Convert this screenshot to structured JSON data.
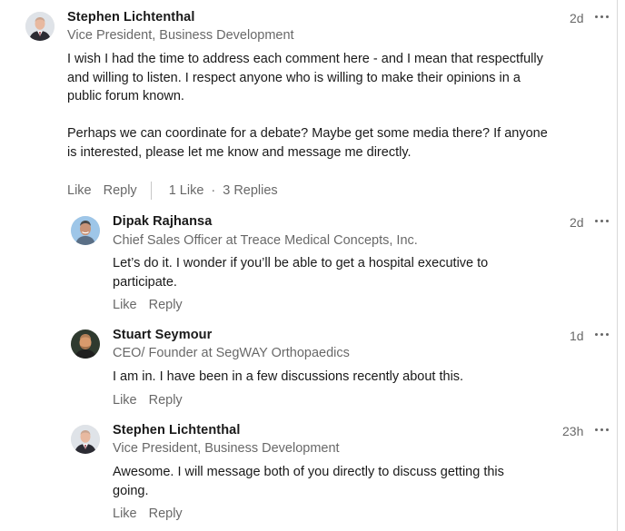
{
  "comments": [
    {
      "name": "Stephen Lichtenthal",
      "headline": "Vice President, Business Development",
      "time": "2d",
      "avatar_icon": "person-suit-avatar-icon",
      "paragraphs": [
        "I wish I had the time to address each comment here - and I mean that respectfully and willing to listen.  I respect anyone who is willing to make their opinions in a public forum known.",
        "Perhaps we can coordinate for a debate?  Maybe get some media there?  If anyone is interested, please let me know and message me directly."
      ],
      "like_label": "Like",
      "reply_label": "Reply",
      "likes_count": "1 Like",
      "replies_count": "3 Replies"
    }
  ],
  "replies": [
    {
      "name": "Dipak Rajhansa",
      "headline": "Chief Sales Officer at Treace Medical Concepts, Inc.",
      "time": "2d",
      "avatar_icon": "person-avatar-icon",
      "text": "Let’s do it. I wonder if you’ll be able to get a hospital executive to participate.",
      "like_label": "Like",
      "reply_label": "Reply"
    },
    {
      "name": "Stuart Seymour",
      "headline": "CEO/ Founder at SegWAY Orthopaedics",
      "time": "1d",
      "avatar_icon": "person-avatar-icon",
      "text": "I am in. I have been in a few discussions recently about this.",
      "like_label": "Like",
      "reply_label": "Reply"
    },
    {
      "name": "Stephen Lichtenthal",
      "headline": "Vice President, Business Development",
      "time": "23h",
      "avatar_icon": "person-suit-avatar-icon",
      "text": "Awesome.  I will message both of you directly to discuss getting this going.",
      "like_label": "Like",
      "reply_label": "Reply"
    }
  ],
  "separator_dot": "·"
}
